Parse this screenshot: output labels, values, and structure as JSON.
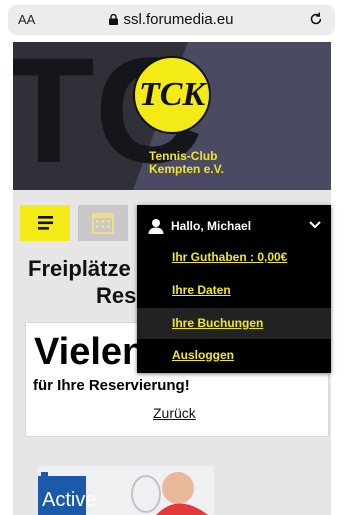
{
  "browser": {
    "text_size_label": "AA",
    "url": "ssl.forumedia.eu"
  },
  "header": {
    "logo_letters": "TCK",
    "club_name_line1": "Tennis-Club",
    "club_name_line2": "Kempten e.V.",
    "accent_color": "#f3ea16"
  },
  "toolbar": {
    "menu_icon": "menu-icon",
    "calendar_icon": "calendar-icon"
  },
  "main": {
    "heading_line1": "Freiplätze",
    "heading_line2": "Res",
    "thanks_big": "Vielen",
    "thanks_sub": "für Ihre Reservierung!",
    "back_link": "Zurück"
  },
  "user_menu": {
    "greeting": "Hallo, Michael",
    "items": [
      {
        "label": "Ihr Guthaben : 0,00€"
      },
      {
        "label": "Ihre Daten"
      },
      {
        "label": "Ihre Buchungen"
      },
      {
        "label": "Ausloggen"
      }
    ]
  },
  "banner": {
    "text": "Active"
  }
}
